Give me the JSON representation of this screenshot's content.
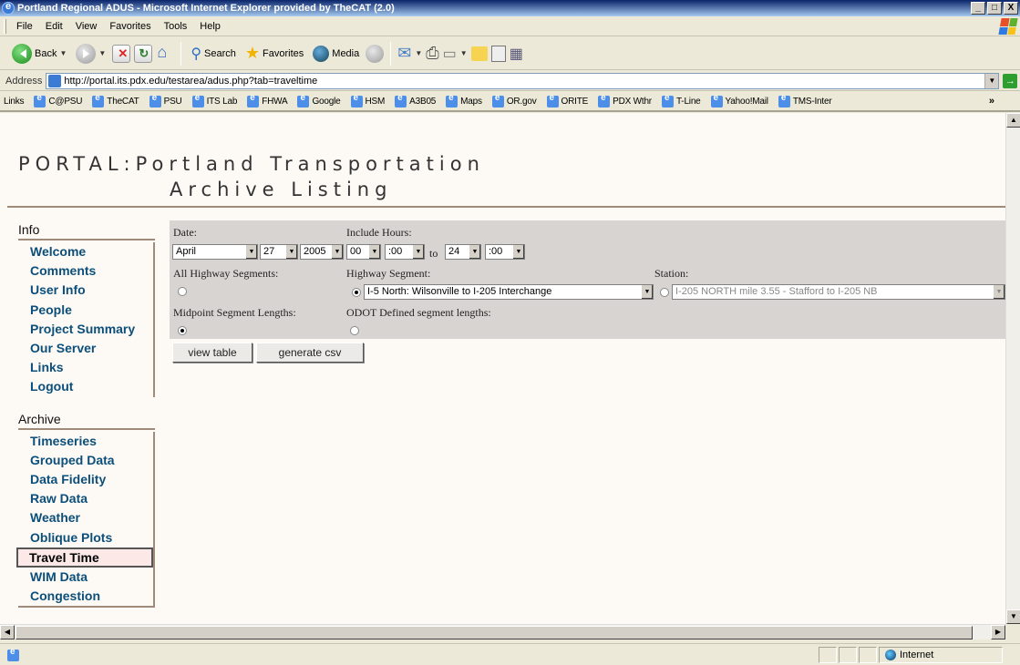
{
  "window": {
    "title": "Portland Regional ADUS - Microsoft Internet Explorer provided by TheCAT (2.0)",
    "controls": [
      "_",
      "□",
      "X"
    ]
  },
  "menu": [
    "File",
    "Edit",
    "View",
    "Favorites",
    "Tools",
    "Help"
  ],
  "toolbar": {
    "back": "Back",
    "search": "Search",
    "favorites": "Favorites",
    "media": "Media"
  },
  "address": {
    "label": "Address",
    "url": "http://portal.its.pdx.edu/testarea/adus.php?tab=traveltime",
    "go": "Go"
  },
  "links": {
    "label": "Links",
    "items": [
      "C@PSU",
      "TheCAT",
      "PSU",
      "ITS Lab",
      "FHWA",
      "Google",
      "HSM",
      "A3B05",
      "Maps",
      "OR.gov",
      "ORITE",
      "PDX Wthr",
      "T-Line",
      "Yahoo!Mail",
      "TMS-Inter"
    ]
  },
  "page": {
    "title_line1": "PORTAL:Portland Transportation",
    "title_line2": "Archive Listing",
    "info_header": "Info",
    "info_items": [
      "Welcome",
      "Comments",
      "User Info",
      "People",
      "Project Summary",
      "Our Server",
      "Links",
      "Logout"
    ],
    "archive_header": "Archive",
    "archive_items": [
      "Timeseries",
      "Grouped Data",
      "Data Fidelity",
      "Raw Data",
      "Weather",
      "Oblique Plots",
      "Travel Time",
      "WIM Data",
      "Congestion"
    ],
    "active_item": "Travel Time"
  },
  "form": {
    "date_label": "Date:",
    "month": "April",
    "day": "27",
    "year": "2005",
    "hours_label": "Include Hours:",
    "start_hour": "00",
    "start_min": ":00",
    "to": "to",
    "end_hour": "24",
    "end_min": ":00",
    "all_segments_label": "All Highway Segments:",
    "segment_label": "Highway Segment:",
    "segment_value": "I-5 North: Wilsonville to I-205 Interchange",
    "station_label": "Station:",
    "station_value": "I-205 NORTH mile 3.55 - Stafford to I-205 NB",
    "midpoint_label": "Midpoint Segment Lengths:",
    "odot_label": "ODOT Defined segment lengths:",
    "view_table": "view table",
    "generate_csv": "generate csv"
  },
  "status": {
    "zone": "Internet"
  }
}
